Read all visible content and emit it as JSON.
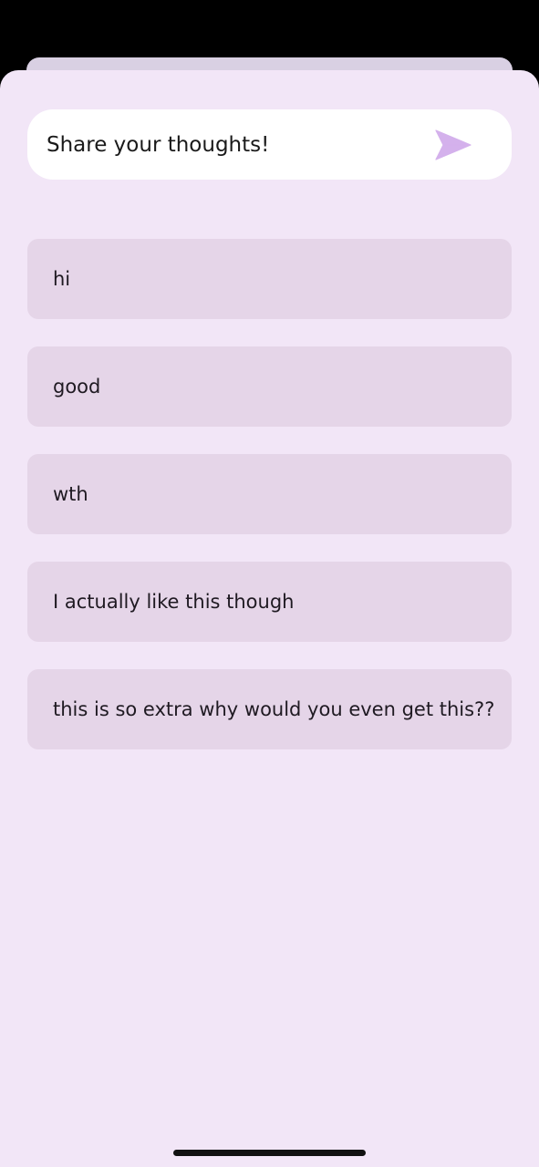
{
  "composer": {
    "placeholder": "Share your thoughts!",
    "send_icon": "send-arrow-icon",
    "send_icon_color": "#d4b1ec"
  },
  "comments": [
    {
      "text": "hi"
    },
    {
      "text": "good"
    },
    {
      "text": "wth"
    },
    {
      "text": "I actually like this though"
    },
    {
      "text": "this is so extra why would you even get this??"
    }
  ],
  "colors": {
    "sheet_background": "#f2e6f7",
    "comment_card": "#e5d5e8",
    "input_background": "#ffffff"
  }
}
